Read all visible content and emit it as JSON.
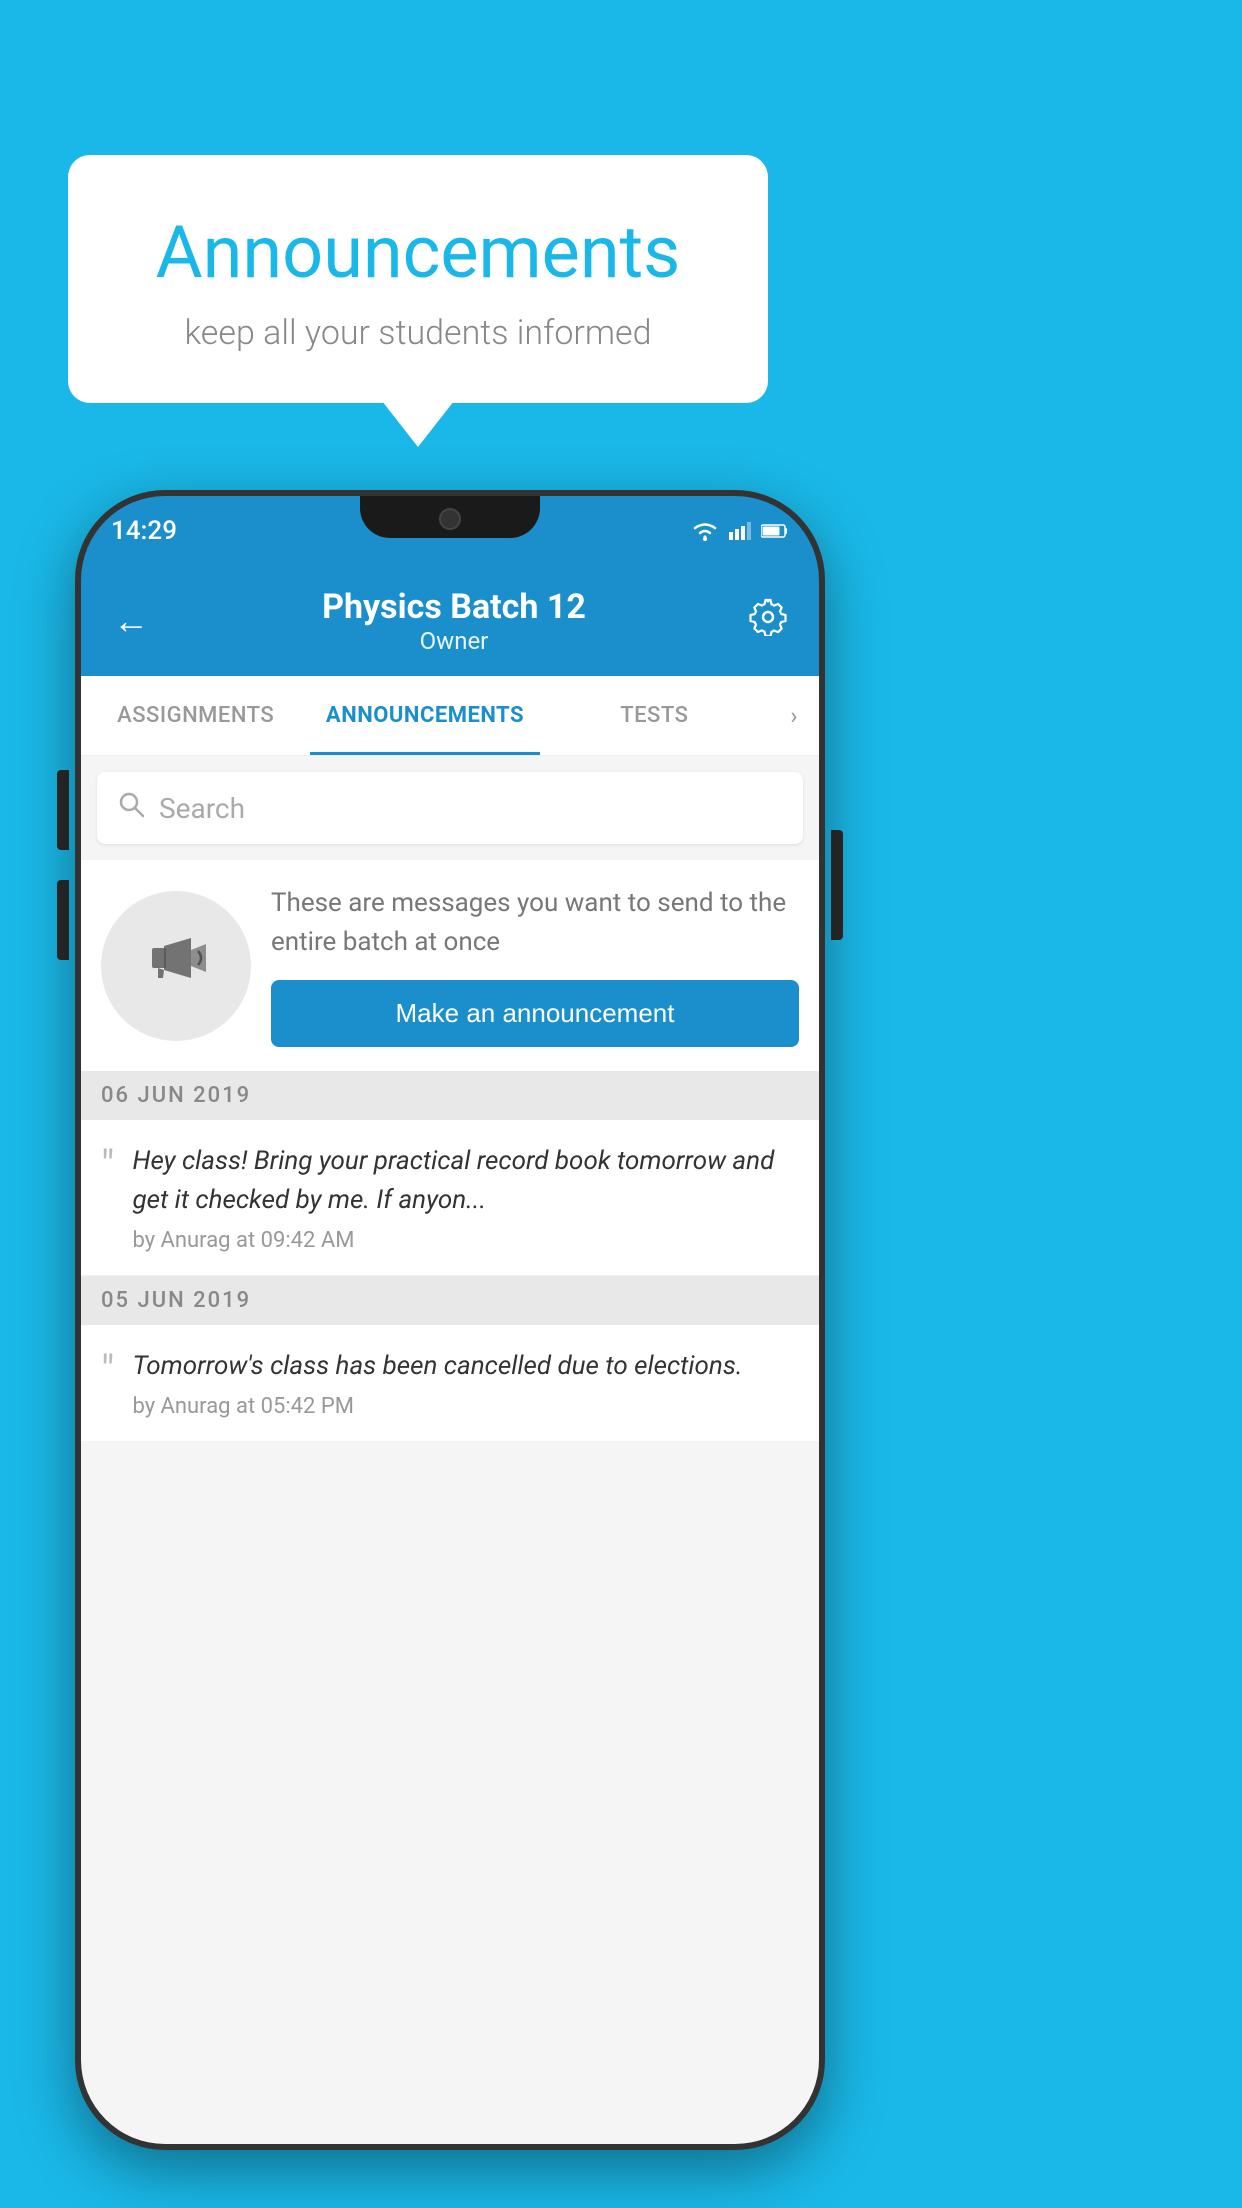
{
  "background_color": "#1ab8e8",
  "speech_bubble": {
    "title": "Announcements",
    "subtitle": "keep all your students informed"
  },
  "status_bar": {
    "time": "14:29",
    "wifi": "▼",
    "battery": "▐"
  },
  "app_bar": {
    "title": "Physics Batch 12",
    "subtitle": "Owner",
    "back_label": "←",
    "settings_label": "⚙"
  },
  "tabs": [
    {
      "label": "ASSIGNMENTS",
      "active": false
    },
    {
      "label": "ANNOUNCEMENTS",
      "active": true
    },
    {
      "label": "TESTS",
      "active": false
    }
  ],
  "search": {
    "placeholder": "Search"
  },
  "promo_card": {
    "description": "These are messages you want to send to the entire batch at once",
    "button_label": "Make an announcement"
  },
  "announcements": [
    {
      "date": "06  JUN  2019",
      "message": "Hey class! Bring your practical record book tomorrow and get it checked by me. If anyon...",
      "meta": "by Anurag at 09:42 AM"
    },
    {
      "date": "05  JUN  2019",
      "message": "Tomorrow's class has been cancelled due to elections.",
      "meta": "by Anurag at 05:42 PM"
    }
  ]
}
